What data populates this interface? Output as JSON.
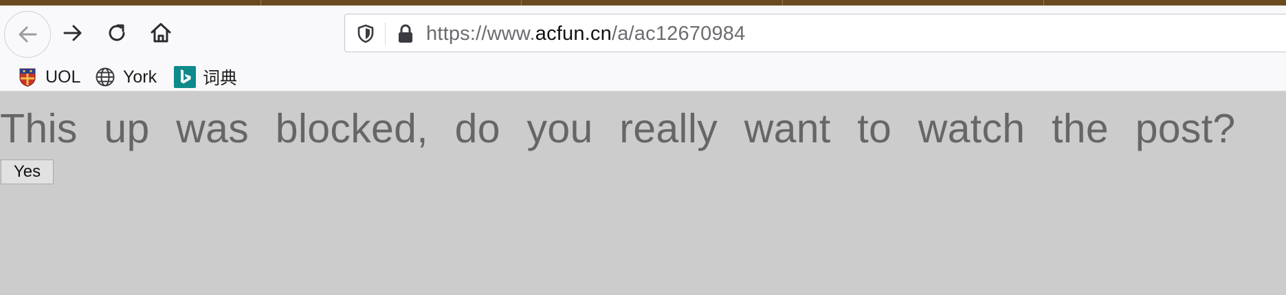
{
  "browser": {
    "url": {
      "scheme_prefix": "https://www.",
      "host": "acfun.cn",
      "path": "/a/ac12670984"
    },
    "bookmarks": [
      {
        "label": "UOL",
        "icon": "uol-crest-icon"
      },
      {
        "label": "York",
        "icon": "globe-icon"
      },
      {
        "label": "词典",
        "icon": "bing-logo-icon"
      }
    ],
    "colors": {
      "tabstrip": "#6b4a1f",
      "toolbar": "#f9f9fb",
      "bing_teal": "#0e8a8a"
    }
  },
  "page": {
    "message": "This up was blocked, do you really want to watch the post?",
    "yes_label": "Yes",
    "background": "#cccccc",
    "message_color": "#666666"
  }
}
